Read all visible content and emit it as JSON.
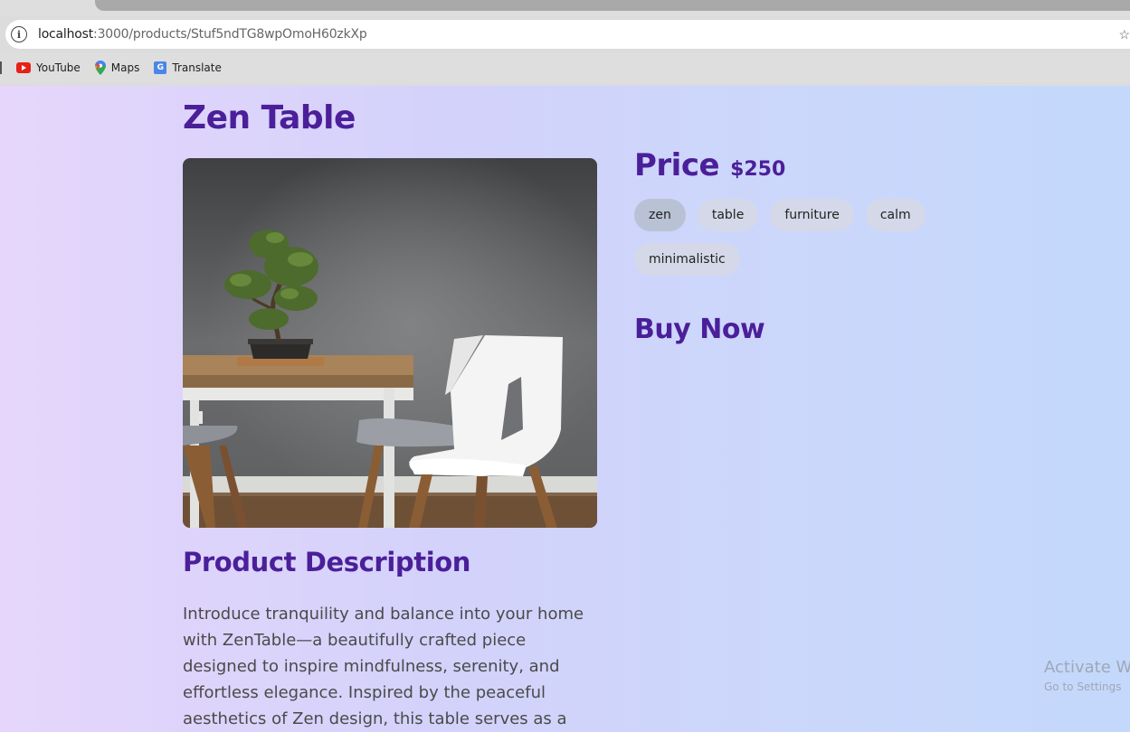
{
  "browser": {
    "url_host": "localhost",
    "url_path": ":3000/products/Stuf5ndTG8wpOmoH60zkXp",
    "bookmarks": [
      {
        "label": "YouTube",
        "icon": "youtube-icon"
      },
      {
        "label": "Maps",
        "icon": "maps-icon"
      },
      {
        "label": "Translate",
        "icon": "translate-icon"
      }
    ]
  },
  "product": {
    "title": "Zen Table",
    "image_alt_icon": "bonsai-table-chairs-photo",
    "price_label": "Price",
    "price_value": "$250",
    "tags": [
      "zen",
      "table",
      "furniture",
      "calm",
      "minimalistic"
    ],
    "buy_label": "Buy Now",
    "description_heading": "Product Description",
    "description": "Introduce tranquility and balance into your home with ZenTable—a beautifully crafted piece designed to inspire mindfulness, serenity, and effortless elegance. Inspired by the peaceful aesthetics of Zen design, this table serves as a"
  },
  "watermark": {
    "line1": "Activate W",
    "line2": "Go to Settings"
  },
  "colors": {
    "accent": "#4b1f99",
    "tag_bg": "#d4d8e8",
    "tag_active_bg": "#b9c2d4"
  }
}
